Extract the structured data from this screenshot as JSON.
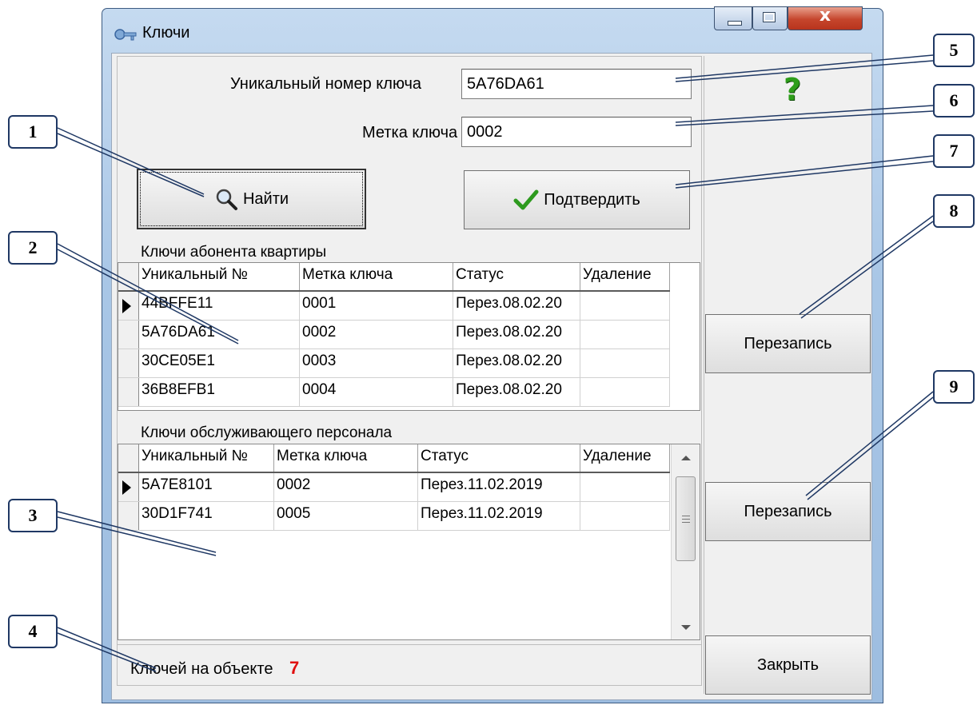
{
  "window": {
    "title": "Ключи"
  },
  "form": {
    "unique_label": "Уникальный номер ключа",
    "unique_value": "5A76DA61",
    "tag_label": "Метка ключа",
    "tag_value": "0002",
    "find_button": "Найти",
    "confirm_button": "Подтвердить",
    "help_glyph": "?"
  },
  "apartment_keys": {
    "title": "Ключи абонента квартиры",
    "columns": [
      "Уникальный №",
      "Метка ключа",
      "Статус",
      "Удаление"
    ],
    "rows": [
      [
        "44BFFE11",
        "0001",
        "Перез.08.02.20",
        ""
      ],
      [
        "5A76DA61",
        "0002",
        "Перез.08.02.20",
        ""
      ],
      [
        "30CE05E1",
        "0003",
        "Перез.08.02.20",
        ""
      ],
      [
        "36B8EFB1",
        "0004",
        "Перез.08.02.20",
        ""
      ]
    ]
  },
  "staff_keys": {
    "title": "Ключи обслуживающего персонала",
    "columns": [
      "Уникальный №",
      "Метка ключа",
      "Статус",
      "Удаление"
    ],
    "rows": [
      [
        "5A7E8101",
        "0002",
        "Перез.11.02.2019",
        ""
      ],
      [
        "30D1F741",
        "0005",
        "Перез.11.02.2019",
        ""
      ]
    ]
  },
  "side": {
    "rewrite_apartment": "Перезапись",
    "rewrite_staff": "Перезапись",
    "close": "Закрыть"
  },
  "status": {
    "keys_label": "Ключей на объекте",
    "keys_count": "7"
  },
  "callouts": [
    "1",
    "2",
    "3",
    "4",
    "5",
    "6",
    "7",
    "8",
    "9"
  ],
  "colors": {
    "count_red": "#e01010",
    "help_green": "#2e9e1a",
    "callout_border": "#1f3864"
  }
}
